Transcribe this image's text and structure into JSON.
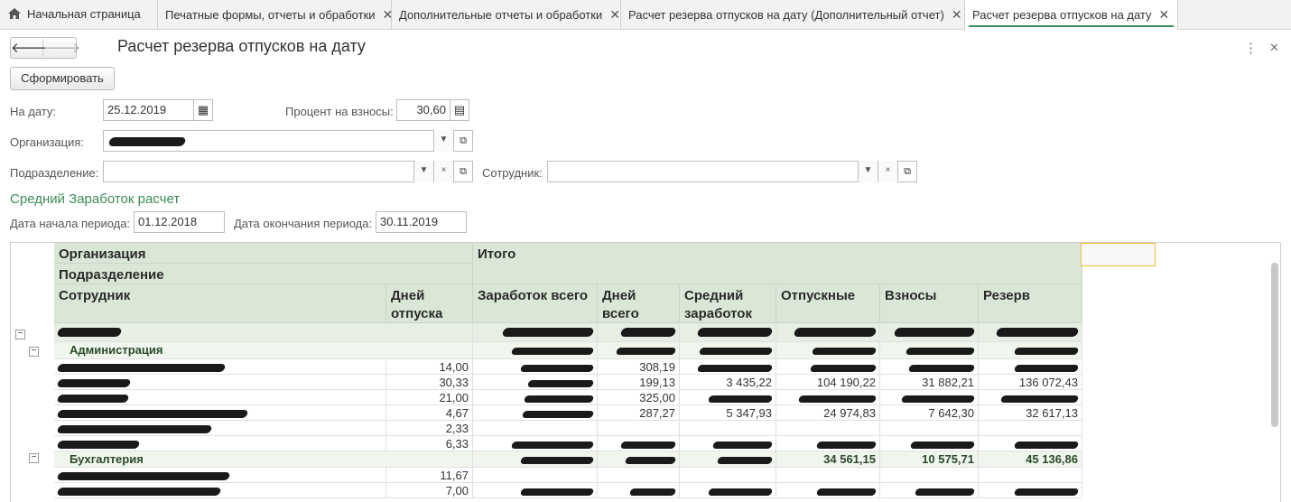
{
  "tabs": [
    {
      "label": "Начальная страница",
      "closable": false,
      "active": false
    },
    {
      "label": "Печатные формы, отчеты и обработки",
      "closable": true,
      "active": false
    },
    {
      "label": "Дополнительные отчеты и обработки",
      "closable": true,
      "active": false
    },
    {
      "label": "Расчет резерва отпусков на дату (Дополнительный отчет)",
      "closable": true,
      "active": false
    },
    {
      "label": "Расчет резерва отпусков на дату",
      "closable": true,
      "active": true
    }
  ],
  "window": {
    "title": "Расчет резерва отпусков на дату"
  },
  "toolbar": {
    "generate_label": "Сформировать"
  },
  "form": {
    "date_label": "На дату:",
    "date_value": "25.12.2019",
    "percent_label": "Процент на взносы:",
    "percent_value": "30,60",
    "org_label": "Организация:",
    "dept_label": "Подразделение:",
    "employee_label": "Сотрудник:"
  },
  "avg_section": {
    "title": "Средний Заработок расчет",
    "start_label": "Дата начала периода:",
    "start_value": "01.12.2018",
    "end_label": "Дата окончания периода:",
    "end_value": "30.11.2019"
  },
  "report": {
    "headers": {
      "org": "Организация",
      "dept": "Подразделение",
      "employee": "Сотрудник",
      "days_vacation": "Дней отпуска",
      "total": "Итого",
      "earnings": "Заработок всего",
      "days_total": "Дней всего",
      "avg": "Средний заработок",
      "vacation_pay": "Отпускные",
      "contrib": "Взносы",
      "reserve": "Резерв"
    },
    "groups": [
      {
        "name": "Администрация",
        "rows": [
          {
            "days": "14,00",
            "days_total": "308,19",
            "avg": "",
            "vac": "",
            "contrib": "",
            "reserve": ""
          },
          {
            "days": "30,33",
            "days_total": "199,13",
            "avg": "3 435,22",
            "vac": "104 190,22",
            "contrib": "31 882,21",
            "reserve": "136 072,43"
          },
          {
            "days": "21,00",
            "days_total": "325,00",
            "avg": "",
            "vac": "",
            "contrib": "",
            "reserve": ""
          },
          {
            "days": "4,67",
            "days_total": "287,27",
            "avg": "5 347,93",
            "vac": "24 974,83",
            "contrib": "7 642,30",
            "reserve": "32 617,13"
          },
          {
            "days": "2,33",
            "days_total": "",
            "avg": "",
            "vac": "",
            "contrib": "",
            "reserve": ""
          },
          {
            "days": "6,33",
            "days_total": "",
            "avg": "",
            "vac": "",
            "contrib": "",
            "reserve": ""
          }
        ]
      },
      {
        "name": "Бухгалтерия",
        "totals": {
          "vac": "34 561,15",
          "contrib": "10 575,71",
          "reserve": "45 136,86"
        },
        "rows": [
          {
            "days": "11,67"
          },
          {
            "days": "7,00"
          }
        ]
      }
    ]
  }
}
